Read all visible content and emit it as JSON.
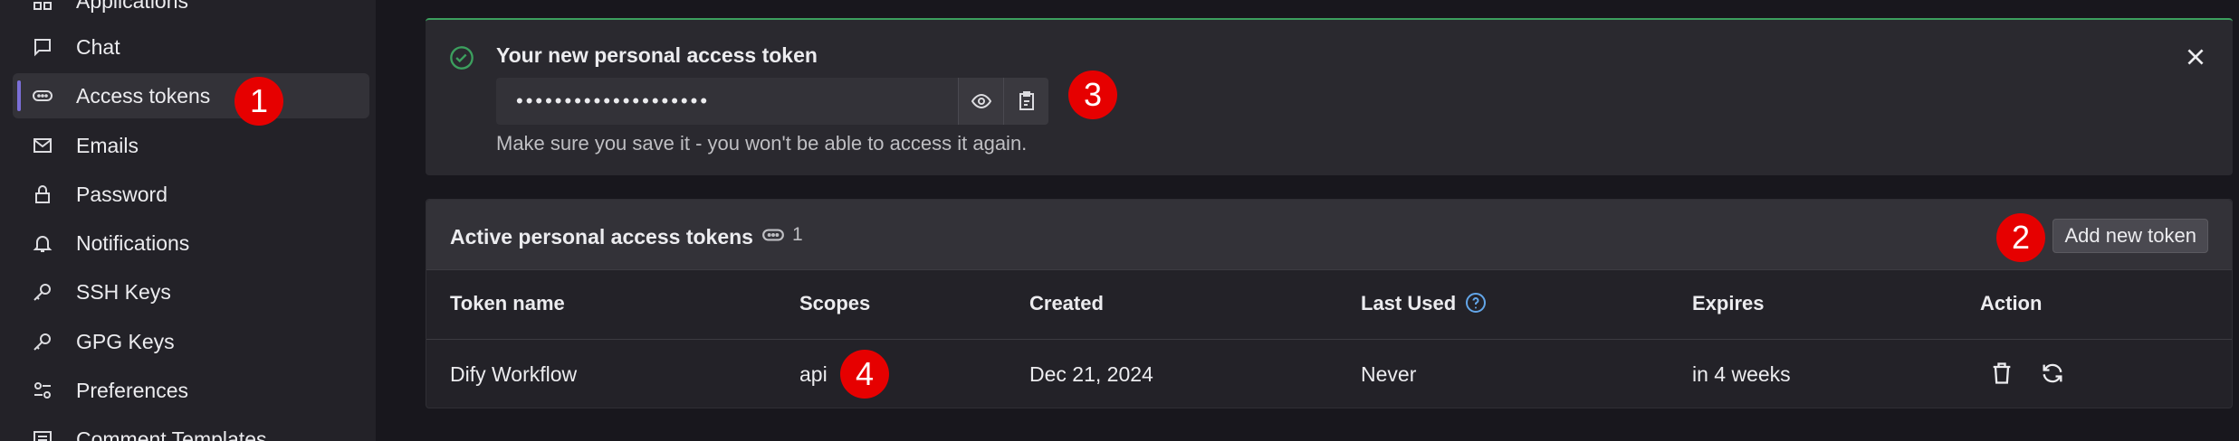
{
  "sidebar": {
    "items": [
      {
        "label": "Applications"
      },
      {
        "label": "Chat"
      },
      {
        "label": "Access tokens"
      },
      {
        "label": "Emails"
      },
      {
        "label": "Password"
      },
      {
        "label": "Notifications"
      },
      {
        "label": "SSH Keys"
      },
      {
        "label": "GPG Keys"
      },
      {
        "label": "Preferences"
      },
      {
        "label": "Comment Templates"
      }
    ],
    "active": "Access tokens"
  },
  "alert": {
    "title": "Your new personal access token",
    "token_masked": "••••••••••••••••••••",
    "note": "Make sure you save it - you won't be able to access it again."
  },
  "tokens_card": {
    "title": "Active personal access tokens",
    "count": "1",
    "add_button": "Add new token",
    "columns": [
      "Token name",
      "Scopes",
      "Created",
      "Last Used",
      "Expires",
      "Action"
    ],
    "rows": [
      {
        "name": "Dify Workflow",
        "scopes": "api",
        "created": "Dec 21, 2024",
        "last_used": "Never",
        "expires": "in 4 weeks"
      }
    ]
  },
  "annotations": [
    "1",
    "2",
    "3",
    "4"
  ],
  "colors": {
    "accent": "#7b6fd8",
    "success": "#3c9f5e",
    "annotation_red": "#e60000",
    "background": "#18171d",
    "sidebar_bg": "#232228"
  }
}
